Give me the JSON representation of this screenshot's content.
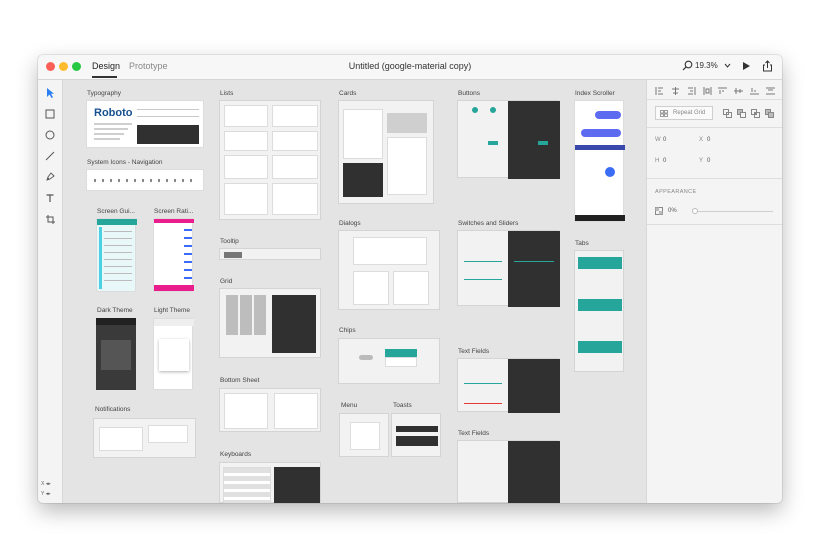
{
  "window": {
    "title": "Untitled (google-material copy)"
  },
  "tabs": {
    "design": "Design",
    "prototype": "Prototype"
  },
  "zoom": {
    "value": "19.3%"
  },
  "toolbar": {
    "coord_x": "X ◂▸",
    "coord_y": "Y ◂▸"
  },
  "artboards": {
    "typography": "Typography",
    "typography_sample": "Roboto",
    "system_icons": "System Icons - Navigation",
    "screen_guides": "Screen Gui...",
    "screen_ratios": "Screen Rati...",
    "dark_theme": "Dark Theme",
    "light_theme": "Light Theme",
    "notifications": "Notifications",
    "lists": "Lists",
    "tooltip": "Tooltip",
    "grid": "Grid",
    "bottom_sheet": "Bottom Sheet",
    "keyboards": "Keyboards",
    "cards": "Cards",
    "dialogs": "Dialogs",
    "chips": "Chips",
    "menu": "Menu",
    "toasts": "Toasts",
    "buttons": "Buttons",
    "switches": "Switches and Sliders",
    "text_fields_1": "Text Fields",
    "text_fields_2": "Text Fields",
    "index_scroller": "Index Scroller",
    "tabs": "Tabs"
  },
  "inspector": {
    "repeat_grid": "Repeat Grid",
    "w_label": "W",
    "w_value": "0",
    "x_label": "X",
    "x_value": "0",
    "h_label": "H",
    "h_value": "0",
    "y_label": "Y",
    "y_value": "0",
    "appearance": "APPEARANCE",
    "opacity": "0%",
    "opacity_fraction": 0
  },
  "colors": {
    "close": "#fc5f57",
    "minimize": "#fdbc2e",
    "maximize": "#28c840",
    "accent_teal": "#26a69a",
    "accent_pink": "#e91e8c",
    "accent_blue": "#3b6cf6",
    "dark_surface": "#303030"
  }
}
